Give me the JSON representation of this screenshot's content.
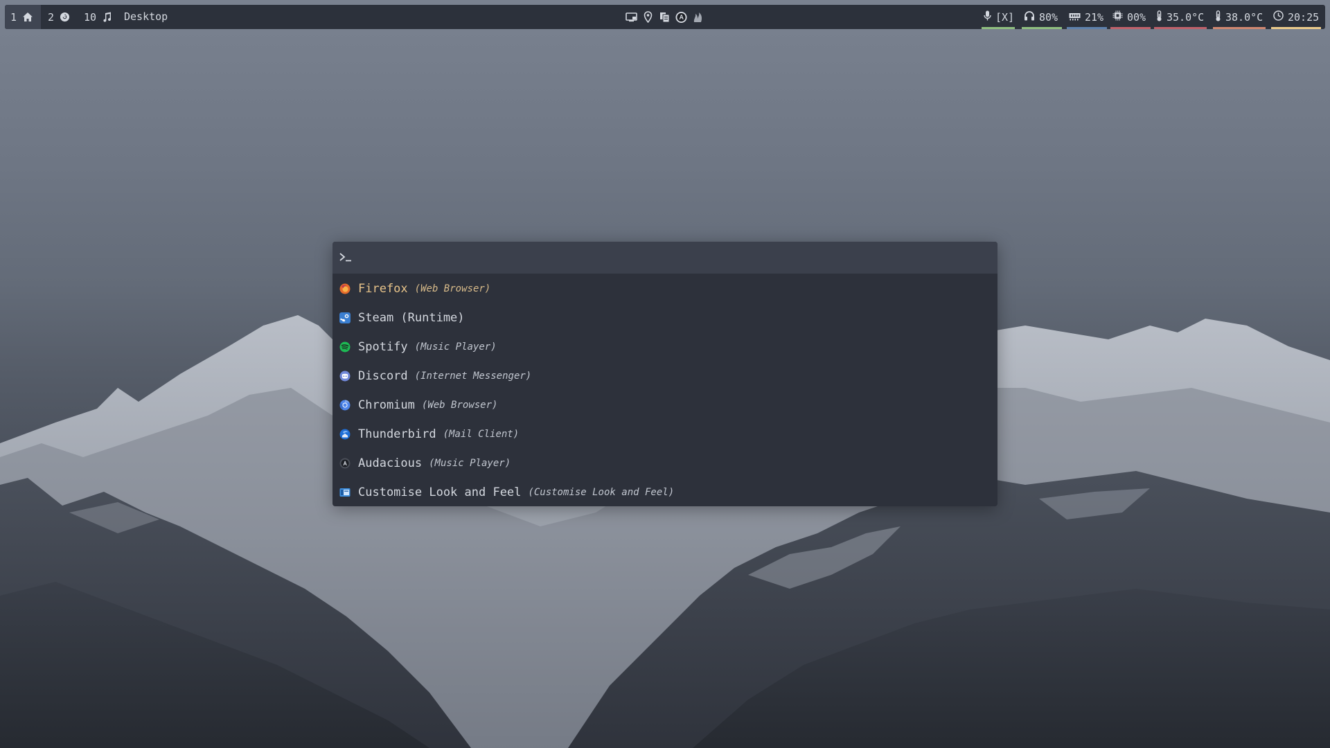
{
  "topbar": {
    "workspaces": [
      {
        "number": "1",
        "icon": "home-icon",
        "active": true
      },
      {
        "number": "2",
        "icon": "refresh-icon",
        "active": false
      },
      {
        "number": "10",
        "icon": "music-note-icon",
        "active": false
      }
    ],
    "window_title": "Desktop",
    "tray_icons": [
      "monitor-icon",
      "location-pin-icon",
      "files-icon",
      "audacious-icon",
      "flame-icon"
    ],
    "status": {
      "microphone": {
        "icon": "microphone-icon",
        "value": "[X]",
        "color": "#8fbf7f"
      },
      "volume": {
        "icon": "headphones-icon",
        "value": "80%",
        "color": "#8fbf7f"
      },
      "memory": {
        "icon": "memory-icon",
        "value": "21%",
        "color": "#5e81ac"
      },
      "cpu": {
        "icon": "cpu-icon",
        "value": "00%",
        "color": "#bf616a"
      },
      "temp1": {
        "icon": "thermometer-icon",
        "value": "35.0°C",
        "color": "#bf616a"
      },
      "temp2": {
        "icon": "thermometer-icon",
        "value": "38.0°C",
        "color": "#d08770"
      },
      "clock": {
        "icon": "clock-icon",
        "value": "20:25",
        "color": "#ebcb8b"
      }
    }
  },
  "launcher": {
    "prompt_icon": "terminal-prompt-icon",
    "query": "",
    "items": [
      {
        "name": "Firefox",
        "description": "(Web Browser)",
        "icon": "firefox-icon",
        "selected": true
      },
      {
        "name": "Steam (Runtime)",
        "description": "",
        "icon": "steam-icon",
        "selected": false
      },
      {
        "name": "Spotify",
        "description": "(Music Player)",
        "icon": "spotify-icon",
        "selected": false
      },
      {
        "name": "Discord",
        "description": "(Internet Messenger)",
        "icon": "discord-icon",
        "selected": false
      },
      {
        "name": "Chromium",
        "description": "(Web Browser)",
        "icon": "chromium-icon",
        "selected": false
      },
      {
        "name": "Thunderbird",
        "description": "(Mail Client)",
        "icon": "thunderbird-icon",
        "selected": false
      },
      {
        "name": "Audacious",
        "description": "(Music Player)",
        "icon": "audacious-icon",
        "selected": false
      },
      {
        "name": "Customise Look and Feel",
        "description": "(Customise Look and Feel)",
        "icon": "appearance-settings-icon",
        "selected": false
      }
    ]
  },
  "colors": {
    "bar_bg": "#2c313b",
    "launcher_bg": "#2d313b",
    "prompt_bg": "#3b404c",
    "selected_text": "#e8c48a",
    "text": "#d4d8df"
  }
}
